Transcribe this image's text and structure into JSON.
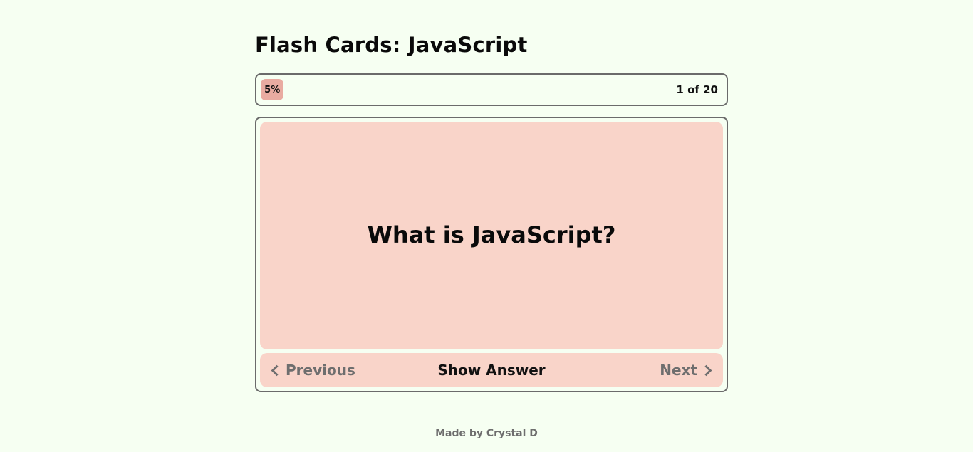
{
  "header": {
    "title": "Flash Cards: JavaScript"
  },
  "progress": {
    "percent_label": "5%",
    "percent": 5,
    "count_label": "1 of 20"
  },
  "card": {
    "question": "What is JavaScript?"
  },
  "controls": {
    "previous_label": "Previous",
    "show_answer_label": "Show Answer",
    "next_label": "Next",
    "previous_icon": "chevron-left-icon",
    "next_icon": "chevron-right-icon"
  },
  "footer": {
    "credit": "Made by Crystal D"
  },
  "colors": {
    "background": "#f6fff2",
    "card": "#f9d4c9",
    "progress_fill": "#e9aba1",
    "border": "#6b6b6b",
    "muted_text": "#6e6e6e"
  }
}
